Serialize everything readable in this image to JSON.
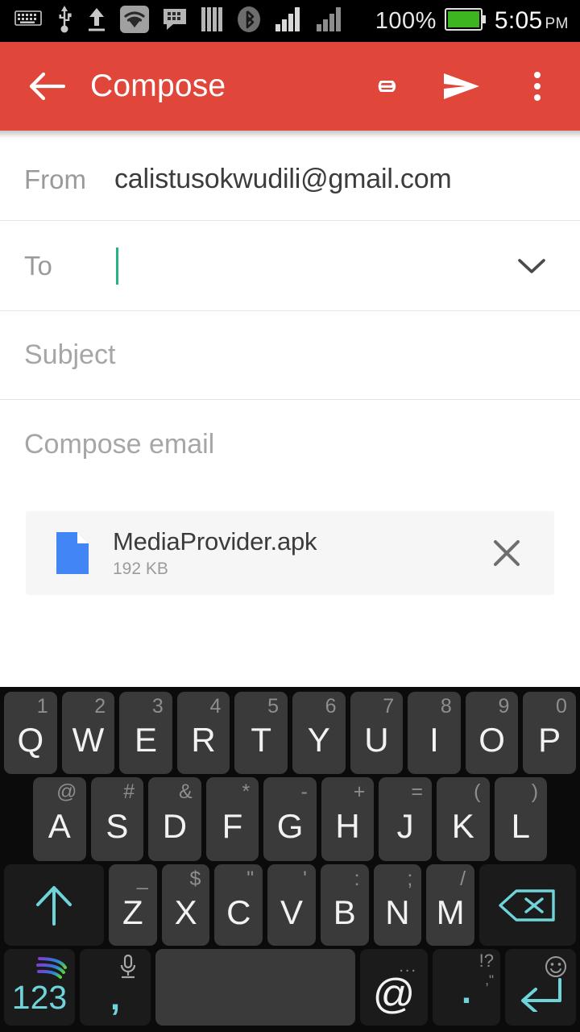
{
  "statusbar": {
    "icons": [
      "keyboard-icon",
      "usb-icon",
      "upload-icon",
      "wifi-icon",
      "bbm-chat-icon",
      "sim-bars-icon",
      "bluetooth-icon",
      "signal-bars-1-icon",
      "signal-bars-2-icon"
    ],
    "battery_percent": "100%",
    "battery_icon": "battery-full-icon",
    "battery_color": "#3cb521",
    "time": "5:05",
    "ampm": "PM"
  },
  "appbar": {
    "back_icon": "arrow-back-icon",
    "title": "Compose",
    "attach_icon": "paperclip-icon",
    "send_icon": "send-icon",
    "overflow_icon": "more-vert-icon",
    "background": "#e0463a"
  },
  "compose": {
    "from_label": "From",
    "from_value": "calistusokwudili@gmail.com",
    "to_label": "To",
    "to_value": "",
    "to_placeholder": "",
    "to_expand_icon": "chevron-down-icon",
    "caret_color": "#27b280",
    "subject_placeholder": "Subject",
    "subject_value": "",
    "body_placeholder": "Compose email",
    "body_value": ""
  },
  "attachment": {
    "file_icon": "file-document-icon",
    "file_icon_color": "#4285f4",
    "name": "MediaProvider.apk",
    "size": "192 KB",
    "remove_icon": "close-icon"
  },
  "keyboard": {
    "name": "swiftkey-keyboard",
    "accent_color": "#6fd4da",
    "row1": [
      {
        "main": "Q",
        "alt": "1"
      },
      {
        "main": "W",
        "alt": "2"
      },
      {
        "main": "E",
        "alt": "3"
      },
      {
        "main": "R",
        "alt": "4"
      },
      {
        "main": "T",
        "alt": "5"
      },
      {
        "main": "Y",
        "alt": "6"
      },
      {
        "main": "U",
        "alt": "7"
      },
      {
        "main": "I",
        "alt": "8"
      },
      {
        "main": "O",
        "alt": "9"
      },
      {
        "main": "P",
        "alt": "0"
      }
    ],
    "row2": [
      {
        "main": "A",
        "alt": "@"
      },
      {
        "main": "S",
        "alt": "#"
      },
      {
        "main": "D",
        "alt": "&"
      },
      {
        "main": "F",
        "alt": "*"
      },
      {
        "main": "G",
        "alt": "-"
      },
      {
        "main": "H",
        "alt": "+"
      },
      {
        "main": "J",
        "alt": "="
      },
      {
        "main": "K",
        "alt": "("
      },
      {
        "main": "L",
        "alt": ")"
      }
    ],
    "row3": [
      {
        "main": "Z",
        "alt": "_"
      },
      {
        "main": "X",
        "alt": "$"
      },
      {
        "main": "C",
        "alt": "\""
      },
      {
        "main": "V",
        "alt": "'"
      },
      {
        "main": "B",
        "alt": ":"
      },
      {
        "main": "N",
        "alt": ";"
      },
      {
        "main": "M",
        "alt": "/"
      }
    ],
    "shift_icon": "shift-arrow-up-icon",
    "backspace_icon": "backspace-icon",
    "symbols_label": "123",
    "swiftkey_logo_icon": "swiftkey-logo-icon",
    "comma_label": ",",
    "mic_icon": "microphone-icon",
    "space_label": "",
    "at_label": "@",
    "at_alt": "...",
    "period_label": ".",
    "period_alt_top": "!?",
    "period_alt_bottom": ",\"",
    "enter_icon": "enter-return-icon",
    "emoji_icon": "smiley-face-icon"
  }
}
